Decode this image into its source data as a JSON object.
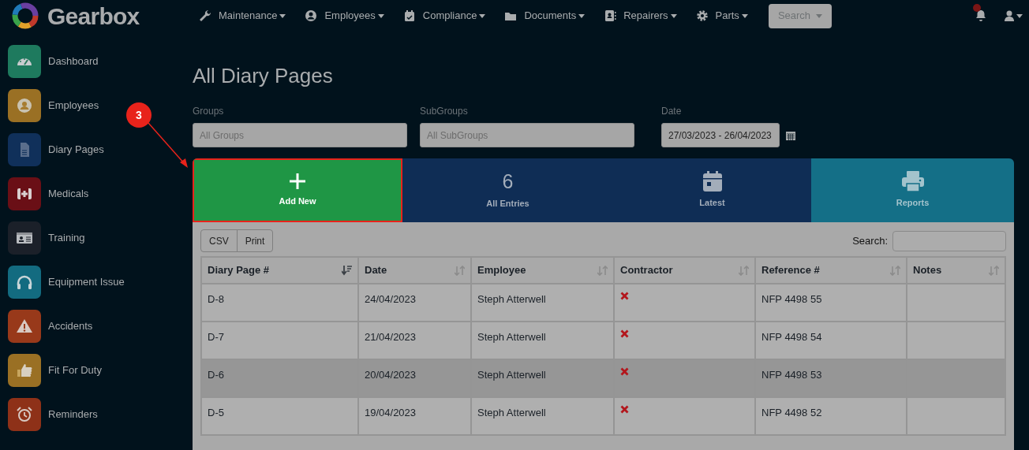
{
  "brand": {
    "name": "Gearbox"
  },
  "nav": [
    {
      "label": "Maintenance"
    },
    {
      "label": "Employees"
    },
    {
      "label": "Compliance"
    },
    {
      "label": "Documents"
    },
    {
      "label": "Repairers"
    },
    {
      "label": "Parts"
    }
  ],
  "search_button": "Search",
  "sidebar": {
    "items": [
      {
        "label": "Dashboard",
        "color": "#1e7a5e"
      },
      {
        "label": "Employees",
        "color": "#9a7024"
      },
      {
        "label": "Diary Pages",
        "color": "#10305a"
      },
      {
        "label": "Medicals",
        "color": "#6a0f16"
      },
      {
        "label": "Training",
        "color": "#1b2029"
      },
      {
        "label": "Equipment Issue",
        "color": "#136b80"
      },
      {
        "label": "Accidents",
        "color": "#98391a"
      },
      {
        "label": "Fit For Duty",
        "color": "#9a7024"
      },
      {
        "label": "Reminders",
        "color": "#8e3118"
      }
    ]
  },
  "page_title": "All Diary Pages",
  "filters": [
    {
      "label": "Groups",
      "placeholder": "All Groups"
    },
    {
      "label": "SubGroups",
      "placeholder": "All SubGroups"
    },
    {
      "label": "Date",
      "value": "27/03/2023 - 26/04/2023",
      "kind": "date"
    }
  ],
  "tiles": [
    {
      "kind": "add",
      "label": "Add New",
      "highlighted": true
    },
    {
      "kind": "count",
      "count": "6",
      "label": "All Entries"
    },
    {
      "kind": "latest",
      "label": "Latest"
    },
    {
      "kind": "reports",
      "label": "Reports"
    }
  ],
  "annotation": {
    "number": "3"
  },
  "table": {
    "buttons": [
      "CSV",
      "Print"
    ],
    "search_label": "Search:",
    "columns": [
      {
        "label": "Diary Page #",
        "sorted": true
      },
      {
        "label": "Date",
        "sorted": false
      },
      {
        "label": "Employee",
        "sorted": false
      },
      {
        "label": "Contractor",
        "sorted": false
      },
      {
        "label": "Reference #",
        "sorted": false
      },
      {
        "label": "Notes",
        "sorted": false
      }
    ],
    "rows": [
      {
        "page": "D-8",
        "date": "24/04/2023",
        "employee": "Steph Atterwell",
        "contractor": false,
        "reference": "NFP 4498 55",
        "highlighted": false
      },
      {
        "page": "D-7",
        "date": "21/04/2023",
        "employee": "Steph Atterwell",
        "contractor": false,
        "reference": "NFP 4498 54",
        "highlighted": false
      },
      {
        "page": "D-6",
        "date": "20/04/2023",
        "employee": "Steph Atterwell",
        "contractor": false,
        "reference": "NFP 4498 53",
        "highlighted": true
      },
      {
        "page": "D-5",
        "date": "19/04/2023",
        "employee": "Steph Atterwell",
        "contractor": false,
        "reference": "NFP 4498 52",
        "highlighted": false
      }
    ]
  }
}
